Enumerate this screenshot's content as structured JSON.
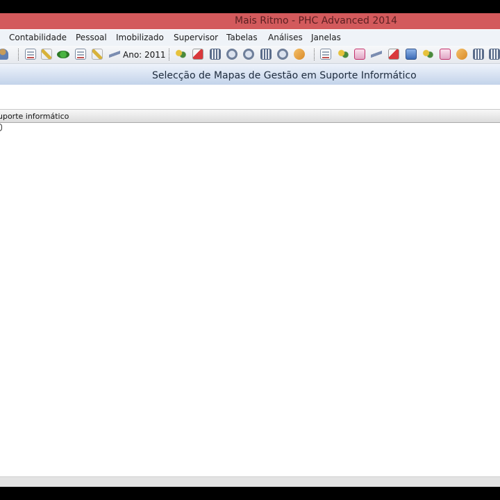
{
  "window": {
    "title": "Mais Ritmo - PHC Advanced 2014"
  },
  "menu": {
    "items": [
      "Contabilidade",
      "Pessoal",
      "Imobilizado",
      "Supervisor",
      "Tabelas",
      "Análises",
      "Janelas"
    ]
  },
  "toolbar": {
    "year_label": "Ano: 2011",
    "icons": [
      "user-icon",
      "document-icon",
      "edit-icon",
      "green-oval-icon",
      "records-icon",
      "pencil-icon",
      "refresh-icon",
      "people-icon",
      "printer-icon",
      "barcode-icon",
      "settings-icon",
      "gear-icon",
      "grid-icon",
      "cog-icon",
      "wrench-icon",
      "report-icon",
      "people-icon",
      "form-icon",
      "arrow-icon",
      "printer-icon",
      "book-icon",
      "people-icon",
      "calendar-icon",
      "hand-icon",
      "table-icon",
      "list-icon"
    ]
  },
  "page": {
    "heading": "Selecção de Mapas de Gestão em Suporte Informático"
  },
  "grid": {
    "column_header": "uporte informático"
  }
}
